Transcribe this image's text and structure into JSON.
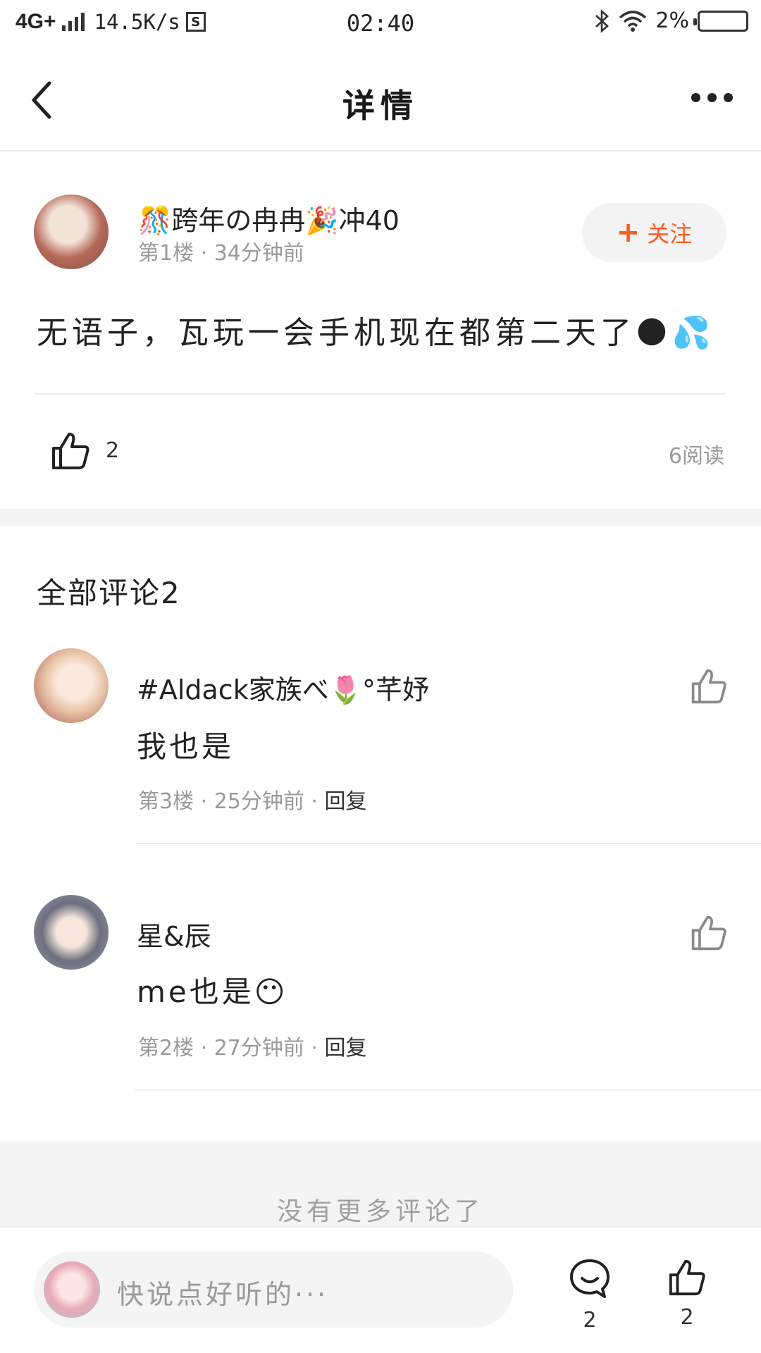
{
  "status_bar": {
    "network": "4G+",
    "speed": "14.5K/s",
    "s_badge": "S",
    "time": "02:40",
    "battery": "2%"
  },
  "header": {
    "title": "详情"
  },
  "post": {
    "author": "🎊跨年の冉冉🎉冲40",
    "meta": "第1楼 · 34分钟前",
    "follow_label": "关注",
    "body": "无语子，瓦玩一会手机现在都第二天了🌑💦",
    "like_count": "2",
    "reads": "6阅读"
  },
  "comments": {
    "title": "全部评论2",
    "items": [
      {
        "name": "#Aldack家族べ🌷°芊妤",
        "text": "我也是",
        "meta": "第3楼 · 25分钟前 · ",
        "reply": "回复"
      },
      {
        "name": "星&辰",
        "text": "me也是😶",
        "meta": "第2楼 · 27分钟前 · ",
        "reply": "回复"
      }
    ],
    "no_more": "没有更多评论了"
  },
  "bottom_bar": {
    "placeholder": "快说点好听的···",
    "comment_count": "2",
    "like_count": "2"
  },
  "colors": {
    "accent": "#ff5a1f",
    "muted_text": "#9a9a9a",
    "band": "#f4f4f4"
  },
  "icons": [
    "back-arrow-icon",
    "more-dots-icon",
    "thumbs-up-icon",
    "comment-bubble-icon",
    "plus-icon"
  ]
}
